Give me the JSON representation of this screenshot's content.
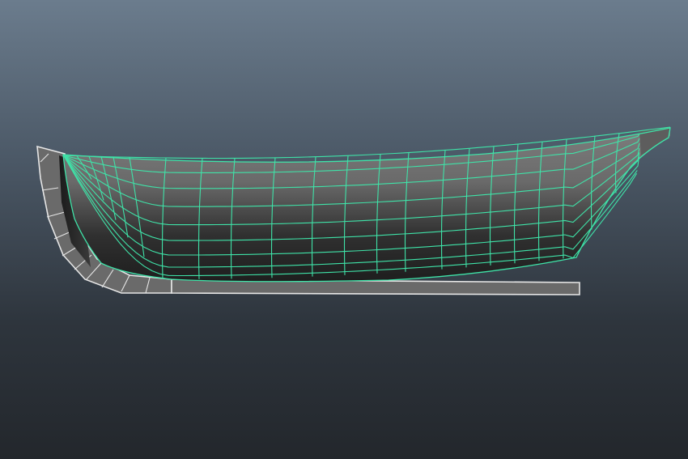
{
  "viewport": {
    "background_top": "#6b7c8d",
    "background_bottom": "#23272c"
  },
  "model": {
    "name": "boat-hull",
    "colors": {
      "wireframe": "#3fe3a8",
      "keel_edge": "#e6e6e6",
      "keel_fill": "#6a6a6a",
      "hull_light": "#7b7b7b",
      "hull_dark": "#232323"
    }
  }
}
